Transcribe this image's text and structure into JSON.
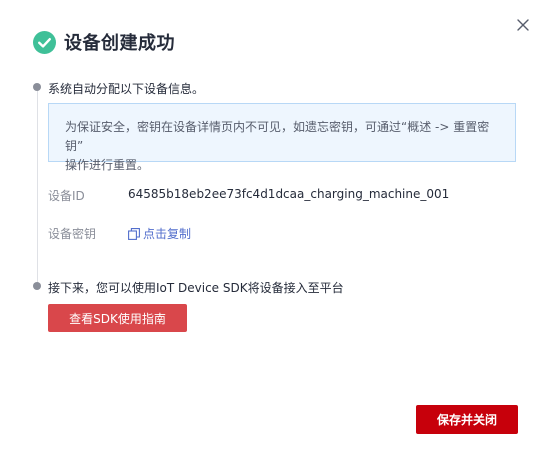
{
  "dialog": {
    "title": "设备创建成功",
    "close_icon": "close-icon",
    "success_icon": "check-circle-icon",
    "colors": {
      "success": "#3fc098",
      "link": "#526ecc",
      "primary_button": "#c7000b",
      "secondary_button": "#d9474b",
      "notice_bg": "#eef6fe",
      "notice_border": "#b8d8f6"
    }
  },
  "step1": {
    "text": "系统自动分配以下设备信息。",
    "notice_line1": "为保证安全，密钥在设备详情页内不可见，如遗忘密钥，可通过“概述 -> 重置密钥”",
    "notice_line2": "操作进行重置。",
    "device_id_label": "设备ID",
    "device_id_value": "64585b18eb2ee73fc4d1dcaa_charging_machine_001",
    "secret_label": "设备密钥",
    "copy_label": "点击复制",
    "copy_icon": "copy-icon"
  },
  "step2": {
    "text": "接下来，您可以使用IoT Device SDK将设备接入至平台",
    "sdk_button_label": "查看SDK使用指南"
  },
  "footer": {
    "save_close_label": "保存并关闭"
  }
}
